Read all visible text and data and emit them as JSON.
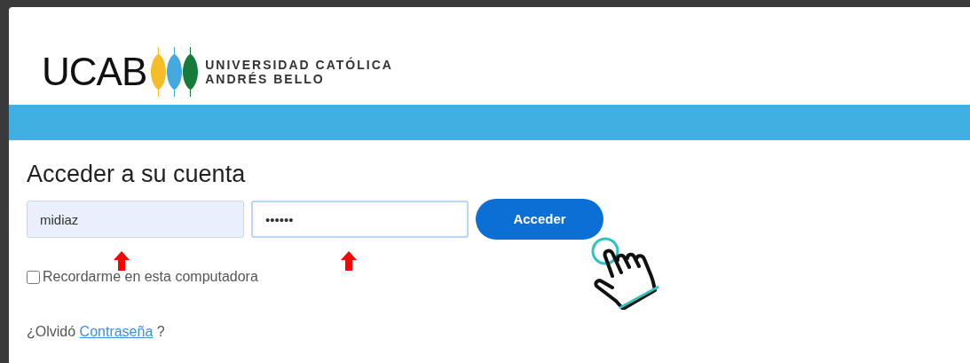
{
  "header": {
    "logo": {
      "acronym": "UCAB",
      "line_1": "UNIVERSIDAD CATÓLICA",
      "line_2": "ANDRÉS BELLO"
    }
  },
  "login": {
    "title": "Acceder a su cuenta",
    "username": {
      "value": "midiaz"
    },
    "password": {
      "value": "••••••"
    },
    "submit": "Acceder",
    "remember": {
      "label": "Recordarme en esta computadora",
      "checked": false
    },
    "forgot": {
      "prefix": "¿Olvidó",
      "link": "Contraseña",
      "suffix": "?"
    }
  }
}
